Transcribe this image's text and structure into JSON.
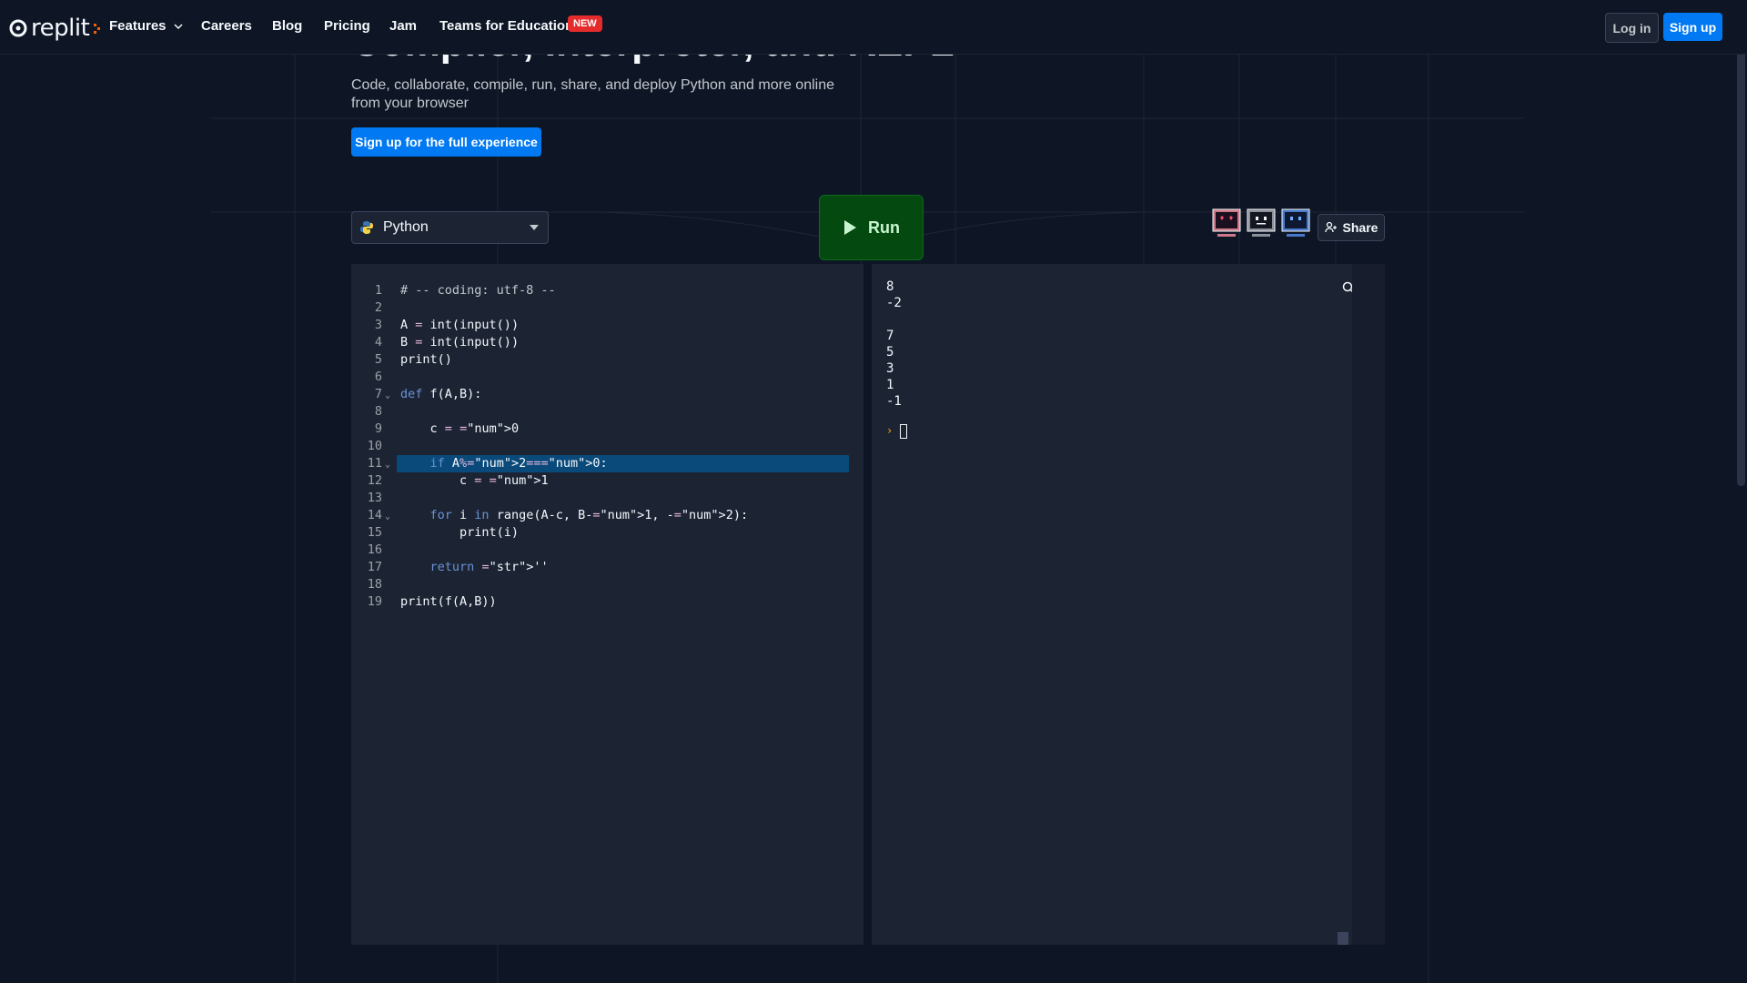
{
  "nav": {
    "logo_text": "replit",
    "items": [
      {
        "label": "Features",
        "has_dropdown": true
      },
      {
        "label": "Careers"
      },
      {
        "label": "Blog"
      },
      {
        "label": "Pricing"
      },
      {
        "label": "Jam"
      },
      {
        "label": "Teams for Education"
      }
    ],
    "new_badge": "NEW",
    "login_label": "Log in",
    "signup_label": "Sign up"
  },
  "hero": {
    "title": "Compiler, Interpreter, and REPL",
    "subtitle": "Code, collaborate, compile, run, share, and deploy Python and more online from your browser",
    "cta_label": "Sign up for the full experience"
  },
  "toolbar": {
    "language": "Python",
    "run_label": "Run",
    "share_label": "Share"
  },
  "editor": {
    "active_line": 11,
    "lines": [
      {
        "n": "1",
        "text": "# -- coding: utf-8 --"
      },
      {
        "n": "2",
        "text": ""
      },
      {
        "n": "3",
        "text": "A = int(input())"
      },
      {
        "n": "4",
        "text": "B = int(input())"
      },
      {
        "n": "5",
        "text": "print()"
      },
      {
        "n": "6",
        "text": ""
      },
      {
        "n": "7",
        "text": "def f(A,B):",
        "fold": true
      },
      {
        "n": "8",
        "text": ""
      },
      {
        "n": "9",
        "text": "    c = 0"
      },
      {
        "n": "10",
        "text": ""
      },
      {
        "n": "11",
        "text": "    if A%2==0:",
        "fold": true
      },
      {
        "n": "12",
        "text": "        c = 1"
      },
      {
        "n": "13",
        "text": ""
      },
      {
        "n": "14",
        "text": "    for i in range(A-c, B-1, -2):",
        "fold": true
      },
      {
        "n": "15",
        "text": "        print(i)"
      },
      {
        "n": "16",
        "text": ""
      },
      {
        "n": "17",
        "text": "    return ''"
      },
      {
        "n": "18",
        "text": ""
      },
      {
        "n": "19",
        "text": "print(f(A,B))"
      }
    ]
  },
  "console": {
    "output": [
      "8",
      "-2",
      "",
      "7",
      "5",
      "3",
      "1",
      "-1"
    ],
    "prompt": "›"
  },
  "colors": {
    "background": "#0e1525",
    "panel": "#1c2333",
    "accent_blue": "#0079f2",
    "run_green": "#044a10",
    "badge_red": "#e52c2c",
    "active_line": "#0a4a7a"
  }
}
